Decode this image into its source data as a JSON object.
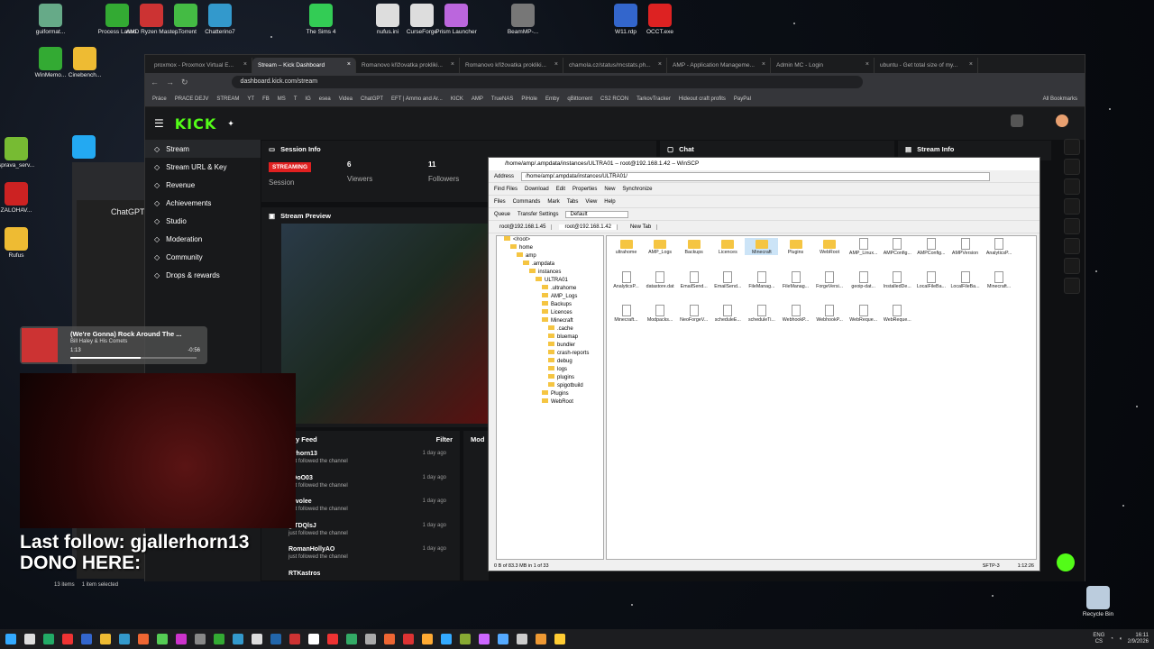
{
  "desktop": {
    "icons_top": [
      {
        "label": "guiformat...",
        "c": "#6a8"
      },
      {
        "label": "Process Lasso",
        "c": "#3a3"
      },
      {
        "label": "AMD Ryzen Master",
        "c": "#c33"
      },
      {
        "label": "µTorrent",
        "c": "#4b4"
      },
      {
        "label": "Chatterino7",
        "c": "#39c"
      },
      {
        "label": "The Sims 4",
        "c": "#3c5"
      },
      {
        "label": "nufus.ini",
        "c": "#ddd"
      },
      {
        "label": "CurseForge",
        "c": "#ddd"
      },
      {
        "label": "Prism Launcher",
        "c": "#b6d"
      },
      {
        "label": "BeamMP-...",
        "c": "#777"
      },
      {
        "label": "W11.rdp",
        "c": "#36c"
      },
      {
        "label": "OCCT.exe",
        "c": "#d22"
      }
    ],
    "icons_left": [
      {
        "label": "WinMemo...",
        "c": "#3a3"
      },
      {
        "label": "Cinebench...",
        "c": "#eb3"
      },
      {
        "label": "sprava_serv...",
        "c": "#7b3"
      },
      {
        "label": "ZALOHAV...",
        "c": "#c22"
      },
      {
        "label": "Rufus",
        "c": "#eb3"
      }
    ],
    "recycle_bin": "Recycle Bin"
  },
  "browser": {
    "tabs": [
      "proxmox - Proxmox Virtual E...",
      "Stream – Kick Dashboard",
      "Romanovo křižovatka prokliki...",
      "Romanovo křižovatka prokliki...",
      "chamola.cz/status/mcstats.ph...",
      "AMP - Application Manageme...",
      "Admin MC - Login",
      "ubuntu - Get total size of my..."
    ],
    "url": "dashboard.kick.com/stream",
    "bookmarks": [
      "Práce",
      "PRACE DEJV",
      "STREAM",
      "YT",
      "FB",
      "MS",
      "T",
      "IG",
      "esea",
      "Videa",
      "ChatGPT",
      "EFT | Ammo and Ar...",
      "KICK",
      "AMP",
      "TrueNAS",
      "PiHole",
      "Emby",
      "qBittorrent",
      "CS2 RCON",
      "TarkovTracker",
      "Hideout craft profits",
      "PayPal"
    ],
    "all_bookmarks": "All Bookmarks"
  },
  "kick": {
    "logo": "KICK",
    "nav": [
      "Stream",
      "Stream URL & Key",
      "Revenue",
      "Achievements",
      "Studio",
      "Moderation",
      "Community",
      "Drops & rewards"
    ],
    "session_info": {
      "title": "Session Info",
      "badge": "STREAMING",
      "label_session": "Session",
      "viewers_count": "6",
      "viewers_label": "Viewers",
      "followers_count": "11",
      "followers_label": "Followers"
    },
    "chat_title": "Chat",
    "stream_info_title": "Stream Info",
    "preview_title": "Stream Preview",
    "feed": {
      "title": "y Feed",
      "filter": "Filter",
      "items": [
        {
          "name": "lerhorn13",
          "sub": "just followed the channel",
          "time": "1 day ago"
        },
        {
          "name": "xOoO03",
          "sub": "just followed the channel",
          "time": "1 day ago"
        },
        {
          "name": "y_volee",
          "sub": "just followed the channel",
          "time": "1 day ago"
        },
        {
          "name": "glTDQlsJ",
          "sub": "just followed the channel",
          "time": "1 day ago"
        },
        {
          "name": "RomanHollyAO",
          "sub": "just followed the channel",
          "time": "1 day ago"
        },
        {
          "name": "RTKastros",
          "sub": "",
          "time": ""
        }
      ]
    },
    "mod_title": "Mod"
  },
  "music": {
    "title": "(We're Gonna) Rock Around The ...",
    "artist": "Bill Haley & His Comets",
    "elapsed": "1:13",
    "remaining": "-0:56",
    "progress": 0.56
  },
  "overlay": {
    "line1": "Last follow: gjallerhorn13",
    "line2": "DONO HERE:"
  },
  "chatgpt": {
    "title": "ChatGPT"
  },
  "winscp": {
    "title": "/home/amp/.ampdata/instances/ULTRA01 – root@192.168.1.42 – WinSCP",
    "address_label": "Address",
    "address": "/home/amp/.ampdata/instances/ULTRA01/",
    "toolbar": [
      "Find Files",
      "Download",
      "Edit",
      "Properties",
      "New",
      "Synchronize"
    ],
    "menu": [
      "Files",
      "Commands",
      "Mark",
      "Tabs",
      "View",
      "Help"
    ],
    "queue": "Queue",
    "transfer_settings": "Transfer Settings",
    "transfer_default": "Default",
    "session_tabs": [
      "root@192.168.1.45",
      "root@192.168.1.42",
      "New Tab"
    ],
    "tree": [
      "</root>",
      "home",
      "amp",
      ".ampdata",
      "instances",
      "ULTRA01",
      ".ultrahome",
      "AMP_Logs",
      "Backups",
      "Licences",
      "Minecraft",
      ".cache",
      "bluemap",
      "bundler",
      "crash-reports",
      "debug",
      "logs",
      "plugins",
      "spigotbuild",
      "Plugins",
      "WebRoot"
    ],
    "files": [
      {
        "n": "ultrahome",
        "t": "f"
      },
      {
        "n": "AMP_Logs",
        "t": "f"
      },
      {
        "n": "Backups",
        "t": "f"
      },
      {
        "n": "Licences",
        "t": "f"
      },
      {
        "n": "Minecraft",
        "t": "f",
        "sel": true
      },
      {
        "n": "Plugins",
        "t": "f"
      },
      {
        "n": "WebRoot",
        "t": "f"
      },
      {
        "n": "AMP_Linux...",
        "t": "d"
      },
      {
        "n": "AMPConfig...",
        "t": "d"
      },
      {
        "n": "AMPConfig...",
        "t": "d"
      },
      {
        "n": "AMPVersion",
        "t": "d"
      },
      {
        "n": "AnalyticsP...",
        "t": "d"
      },
      {
        "n": "AnalyticsP...",
        "t": "d"
      },
      {
        "n": "datastore.dat",
        "t": "d"
      },
      {
        "n": "EmailSend...",
        "t": "d"
      },
      {
        "n": "EmailSend...",
        "t": "d"
      },
      {
        "n": "FileManag...",
        "t": "d"
      },
      {
        "n": "FileManag...",
        "t": "d"
      },
      {
        "n": "ForgeVersi...",
        "t": "d"
      },
      {
        "n": "geoip-dat...",
        "t": "d"
      },
      {
        "n": "InstalledDe...",
        "t": "d"
      },
      {
        "n": "LocalFileBa...",
        "t": "d"
      },
      {
        "n": "LocalFileBa...",
        "t": "d"
      },
      {
        "n": "Minecraft...",
        "t": "d"
      },
      {
        "n": "Minecraft...",
        "t": "d"
      },
      {
        "n": "Modpacks...",
        "t": "d"
      },
      {
        "n": "NeoForgeV...",
        "t": "d"
      },
      {
        "n": "scheduleE...",
        "t": "d"
      },
      {
        "n": "scheduleTi...",
        "t": "d"
      },
      {
        "n": "WebhookP...",
        "t": "d"
      },
      {
        "n": "WebhookP...",
        "t": "d"
      },
      {
        "n": "WebReque...",
        "t": "d"
      },
      {
        "n": "WebReque...",
        "t": "d"
      }
    ],
    "status": "0 B of 83.3 MB in 1 of 33",
    "protocol": "SFTP-3",
    "time": "1:12:26"
  },
  "explorer_status": {
    "items": "13 items",
    "selected": "1 item selected"
  },
  "taskbar": {
    "lang": "ENG",
    "region": "CS",
    "time": "16:11",
    "date": "2/9/2026",
    "icons": [
      "#ddd",
      "#2a6",
      "#e33",
      "#36c",
      "#eb3",
      "#39c",
      "#e63",
      "#5c5",
      "#c3c",
      "#888",
      "#3a3",
      "#39c",
      "#ddd",
      "#26a",
      "#c33",
      "#fff",
      "#e33",
      "#3a6",
      "#aaa",
      "#e63",
      "#d33",
      "#fa3",
      "#3af",
      "#8a3",
      "#c6f",
      "#5af",
      "#ccc",
      "#e93",
      "#fc3"
    ]
  }
}
